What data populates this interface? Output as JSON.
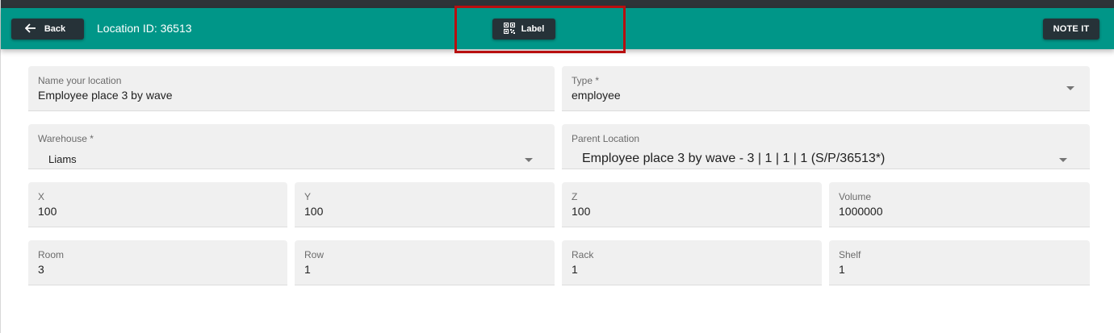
{
  "appbar": {
    "back_label": "Back",
    "title": "Location ID: 36513",
    "label_button": "Label",
    "note_button": "NOTE IT",
    "color": "#009688"
  },
  "form": {
    "name": {
      "label": "Name your location",
      "value": "Employee place 3 by wave"
    },
    "type": {
      "label": "Type *",
      "value": "employee"
    },
    "warehouse": {
      "label": "Warehouse *",
      "value": "Liams"
    },
    "parent": {
      "label": "Parent Location",
      "value": "Employee place 3 by wave - 3 | 1 | 1 | 1 (S/P/36513*)"
    },
    "x": {
      "label": "X",
      "value": "100"
    },
    "y": {
      "label": "Y",
      "value": "100"
    },
    "z": {
      "label": "Z",
      "value": "100"
    },
    "volume": {
      "label": "Volume",
      "value": "1000000"
    },
    "room": {
      "label": "Room",
      "value": "3"
    },
    "row": {
      "label": "Row",
      "value": "1"
    },
    "rack": {
      "label": "Rack",
      "value": "1"
    },
    "shelf": {
      "label": "Shelf",
      "value": "1"
    }
  },
  "icons": {
    "back": "arrow-left-icon",
    "label": "qr-code-icon",
    "dropdown": "caret-down-icon"
  },
  "highlight_color": "#b80f0f"
}
